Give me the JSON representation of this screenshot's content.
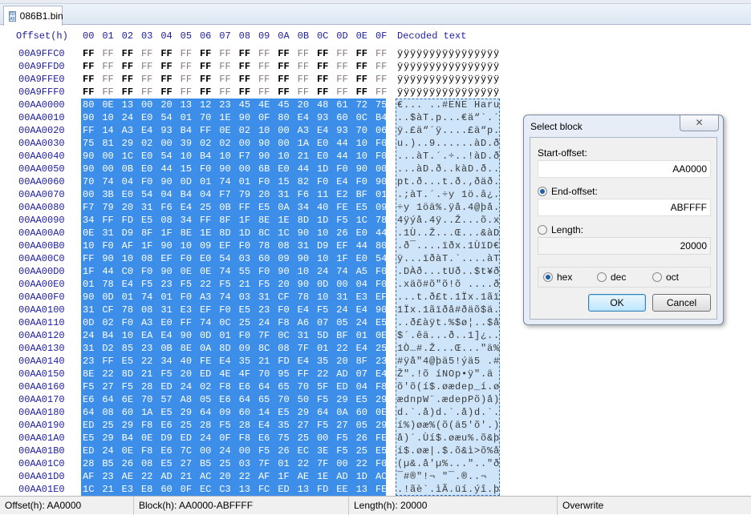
{
  "tab": {
    "filename": "086B1.bin"
  },
  "header": {
    "offset_label": "Offset(h)",
    "columns": [
      "00",
      "01",
      "02",
      "03",
      "04",
      "05",
      "06",
      "07",
      "08",
      "09",
      "0A",
      "0B",
      "0C",
      "0D",
      "0E",
      "0F"
    ],
    "decoded_label": "Decoded text"
  },
  "rows": [
    {
      "offset": "00A9FFC0",
      "bytes": "FF FF FF FF FF FF FF FF FF FF FF FF FF FF FF FF",
      "selected": false
    },
    {
      "offset": "00A9FFD0",
      "bytes": "FF FF FF FF FF FF FF FF FF FF FF FF FF FF FF FF",
      "selected": false
    },
    {
      "offset": "00A9FFE0",
      "bytes": "FF FF FF FF FF FF FF FF FF FF FF FF FF FF FF FF",
      "selected": false
    },
    {
      "offset": "00A9FFF0",
      "bytes": "FF FF FF FF FF FF FF FF FF FF FF FF FF FF FF FF",
      "selected": false
    },
    {
      "offset": "00AA0000",
      "bytes": "80 0E 13 00 20 13 12 23 45 4E 45 20 48 61 72 75",
      "selected": true
    },
    {
      "offset": "00AA0010",
      "bytes": "90 10 24 E0 54 01 70 1E 90 0F 80 E4 93 60 0C B4",
      "selected": true
    },
    {
      "offset": "00AA0020",
      "bytes": "FF 14 A3 E4 93 B4 FF 0E 02 10 00 A3 E4 93 70 06",
      "selected": true
    },
    {
      "offset": "00AA0030",
      "bytes": "75 81 29 02 00 39 02 02 00 90 00 1A E0 44 10 F0",
      "selected": true
    },
    {
      "offset": "00AA0040",
      "bytes": "90 00 1C E0 54 10 B4 10 F7 90 10 21 E0 44 10 F0",
      "selected": true
    },
    {
      "offset": "00AA0050",
      "bytes": "90 00 0B E0 44 15 F0 90 00 6B E0 44 1D F0 90 00",
      "selected": true
    },
    {
      "offset": "00AA0060",
      "bytes": "70 74 04 F0 90 0D 01 74 01 F0 15 82 F0 E4 F0 90",
      "selected": true
    },
    {
      "offset": "00AA0070",
      "bytes": "00 3B E0 54 04 B4 04 F7 79 20 31 F6 11 E2 BF 01",
      "selected": true
    },
    {
      "offset": "00AA0080",
      "bytes": "F7 79 20 31 F6 E4 25 0B FF E5 0A 34 40 FE E5 09",
      "selected": true
    },
    {
      "offset": "00AA0090",
      "bytes": "34 FF FD E5 08 34 FF 8F 1F 8E 1E 8D 1D F5 1C 78",
      "selected": true
    },
    {
      "offset": "00AA00A0",
      "bytes": "0E 31 D9 8F 1F 8E 1E 8D 1D 8C 1C 90 10 26 E0 44",
      "selected": true
    },
    {
      "offset": "00AA00B0",
      "bytes": "10 F0 AF 1F 90 10 09 EF F0 78 08 31 D9 EF 44 80",
      "selected": true
    },
    {
      "offset": "00AA00C0",
      "bytes": "FF 90 10 08 EF F0 E0 54 03 60 09 90 10 1F E0 54",
      "selected": true
    },
    {
      "offset": "00AA00D0",
      "bytes": "1F 44 C0 F0 90 0E 0E 74 55 F0 90 10 24 74 A5 F0",
      "selected": true
    },
    {
      "offset": "00AA00E0",
      "bytes": "01 78 E4 F5 23 F5 22 F5 21 F5 20 90 0D 00 04 F0",
      "selected": true
    },
    {
      "offset": "00AA00F0",
      "bytes": "90 0D 01 74 01 F0 A3 74 03 31 CF 78 10 31 E3 EF",
      "selected": true
    },
    {
      "offset": "00AA0100",
      "bytes": "31 CF 78 08 31 E3 EF F0 E5 23 F0 E4 F5 24 E4 90",
      "selected": true
    },
    {
      "offset": "00AA0110",
      "bytes": "0D 02 F0 A3 E0 FF 74 0C 25 24 F8 A6 07 05 24 E5",
      "selected": true
    },
    {
      "offset": "00AA0120",
      "bytes": "24 B4 10 EA E4 90 0D 01 F0 7F 0C 31 5D BF 01 0E",
      "selected": true
    },
    {
      "offset": "00AA0130",
      "bytes": "31 D2 85 23 0B 8E 0A 8D 09 8C 08 7F 01 22 E4 25",
      "selected": true
    },
    {
      "offset": "00AA0140",
      "bytes": "23 FF E5 22 34 40 FE E4 35 21 FD E4 35 20 8F 23",
      "selected": true
    },
    {
      "offset": "00AA0150",
      "bytes": "8E 22 8D 21 F5 20 ED 4E 4F 70 95 FF 22 AD 07 E4",
      "selected": true
    },
    {
      "offset": "00AA0160",
      "bytes": "F5 27 F5 28 ED 24 02 F8 E6 64 65 70 5F ED 04 F8",
      "selected": true
    },
    {
      "offset": "00AA0170",
      "bytes": "E6 64 6E 70 57 A8 05 E6 64 65 70 50 F5 29 E5 29",
      "selected": true
    },
    {
      "offset": "00AA0180",
      "bytes": "64 08 60 1A E5 29 64 09 60 14 E5 29 64 0A 60 0E",
      "selected": true
    },
    {
      "offset": "00AA0190",
      "bytes": "ED 25 29 F8 E6 25 28 F5 28 E4 35 27 F5 27 05 29",
      "selected": true
    },
    {
      "offset": "00AA01A0",
      "bytes": "E5 29 B4 0E D9 ED 24 0F F8 E6 75 25 00 F5 26 FE",
      "selected": true
    },
    {
      "offset": "00AA01B0",
      "bytes": "ED 24 0E F8 E6 7C 00 24 00 F5 26 EC 3E F5 25 E5",
      "selected": true
    },
    {
      "offset": "00AA01C0",
      "bytes": "28 B5 26 08 E5 27 B5 25 03 7F 01 22 7F 00 22 F0",
      "selected": true
    },
    {
      "offset": "00AA01D0",
      "bytes": "AF 23 AE 22 AD 21 AC 20 22 AF 1F AE 1E AD 1D AC",
      "selected": true
    },
    {
      "offset": "00AA01E0",
      "bytes": "1C 21 E3 E8 60 0F EC C3 13 FC ED 13 FD EE 13 FE",
      "selected": true
    }
  ],
  "status": {
    "offset": "Offset(h): AA0000",
    "block": "Block(h): AA0000-ABFFFF",
    "length": "Length(h): 20000",
    "mode": "Overwrite"
  },
  "dialog": {
    "title": "Select block",
    "close": "✕",
    "start_label": "Start-offset:",
    "start_value": "AA0000",
    "end_label": "End-offset:",
    "end_value": "ABFFFF",
    "length_label": "Length:",
    "length_value": "20000",
    "base_options": [
      "hex",
      "dec",
      "oct"
    ],
    "base_selected": "hex",
    "range_mode": "end",
    "ok": "OK",
    "cancel": "Cancel"
  },
  "colors": {
    "selection": "#3d8ee8",
    "offset_text": "#1d1da0",
    "odd_byte": "#8a7878"
  }
}
